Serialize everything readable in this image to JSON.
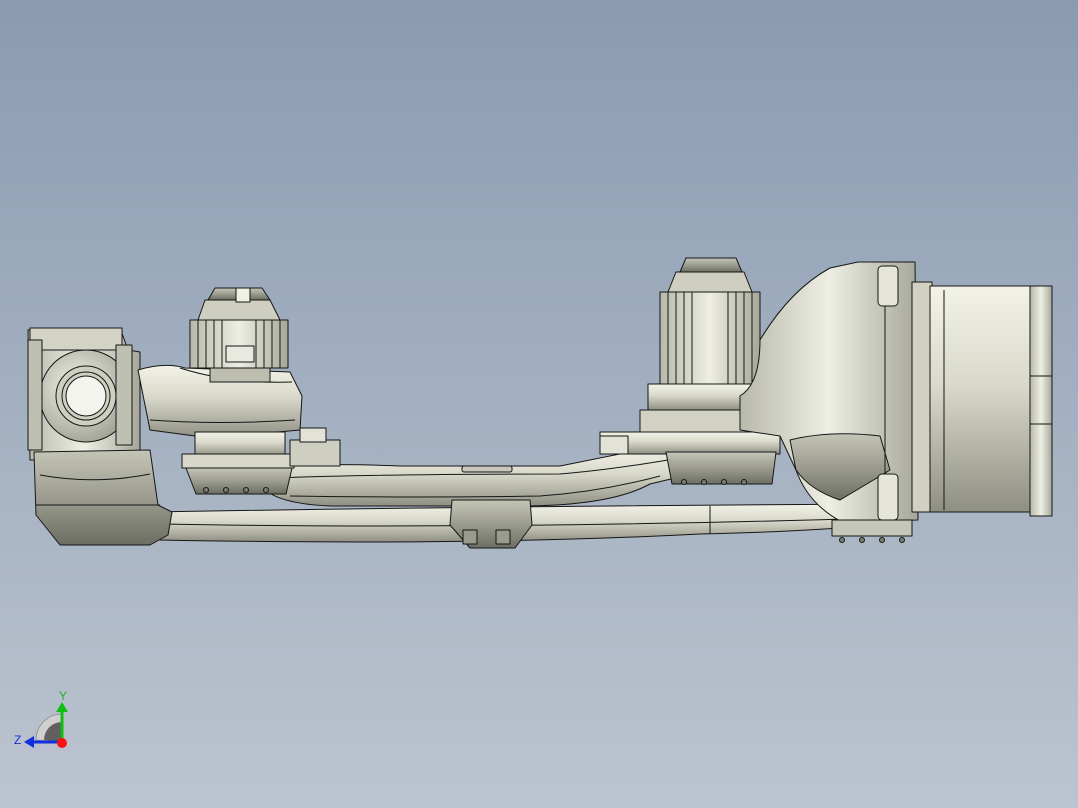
{
  "viewport": {
    "background_top": "#8a9bb1",
    "background_bottom": "#bcc4cf",
    "model_fill": "#dcdccf",
    "model_shade": "#a9aa9c",
    "model_edge": "#161616"
  },
  "triad": {
    "y_label": "Y",
    "z_label": "Z",
    "x_color": "#ff1010",
    "y_color": "#10c010",
    "z_color": "#1030e0"
  }
}
